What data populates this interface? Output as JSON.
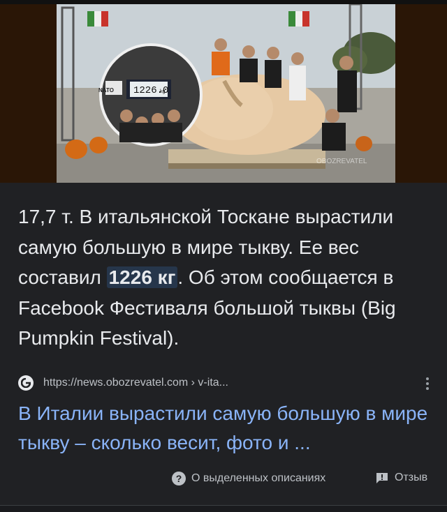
{
  "snippet": {
    "text_before": "17,7 т. В итальянской Тоскане вырастили самую большую в мире тыкву. Ее вес составил ",
    "highlight": "1226 кг",
    "text_after": ". Об этом сообщается в Facebook Фестиваля большой тыквы (Big Pumpkin Festival)."
  },
  "image": {
    "scale_display": "1226.0",
    "scale_unit": "kg",
    "banner_text": "NATO",
    "watermark": "OBOZREVATEL"
  },
  "source": {
    "url": "https://news.obozrevatel.com › v-ita...",
    "favicon": "obozrevatel-logo-icon"
  },
  "result": {
    "title": "В Италии вырастили самую большую в мире тыкву – сколько весит, фото и ..."
  },
  "footer": {
    "about_label": "О выделенных описаниях",
    "feedback_label": "Отзыв"
  },
  "colors": {
    "background": "#202124",
    "link": "#8ab4f8",
    "highlight_bg": "#26364b",
    "text": "#e8eaed",
    "muted": "#bdc1c6"
  }
}
